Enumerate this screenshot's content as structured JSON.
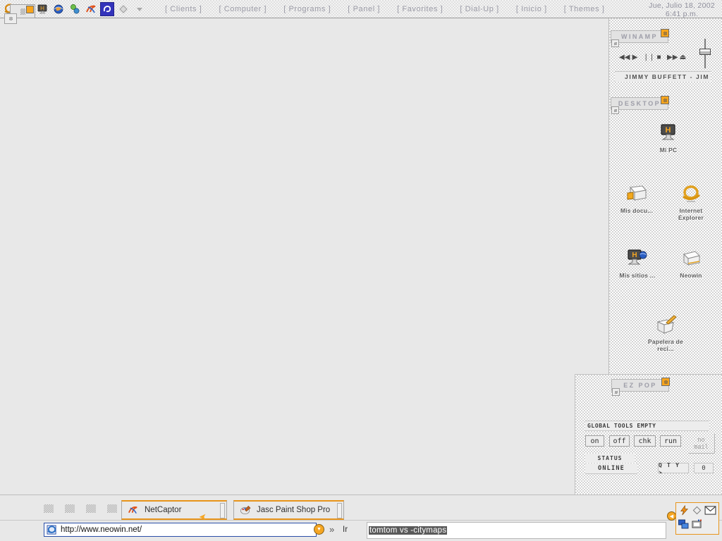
{
  "topbar": {
    "icons": [
      {
        "name": "internet-explorer-icon",
        "glyph": "🌐"
      },
      {
        "name": "white-animal-icon",
        "glyph": "🐕"
      },
      {
        "name": "my-computer-icon",
        "glyph": "🖥"
      },
      {
        "name": "globe-icon",
        "glyph": "🌎"
      },
      {
        "name": "spheres-icon",
        "glyph": "⊙"
      },
      {
        "name": "netcaptor-icon",
        "glyph": "↗"
      },
      {
        "name": "active-app-icon",
        "glyph": "◐"
      },
      {
        "name": "diamond-icon",
        "glyph": "◇"
      },
      {
        "name": "chevron-down-icon",
        "glyph": "▾"
      }
    ],
    "menus": [
      "[ Clients ]",
      "[ Computer ]",
      "[ Programs ]",
      "[ Panel ]",
      "[ Favorites ]",
      "[ Dial-Up ]",
      "[ Inicio ]",
      "[ Themes ]"
    ],
    "clock": {
      "date": "Jue, Julio 18, 2002",
      "time": "6:41 p.m."
    }
  },
  "winamp": {
    "title": "WINAMP",
    "controls": [
      {
        "name": "previous-track-button",
        "glyph": "◀◀"
      },
      {
        "name": "play-button",
        "glyph": "▶"
      },
      {
        "name": "pause-button",
        "glyph": "❘❘"
      },
      {
        "name": "stop-button",
        "glyph": "■"
      },
      {
        "name": "next-track-button",
        "glyph": "▶▶"
      },
      {
        "name": "eject-button",
        "glyph": "⏏"
      }
    ],
    "track": "JIMMY BUFFETT - JIM"
  },
  "desktop": {
    "title": "DESKTOP",
    "icons": [
      {
        "name": "mi-pc",
        "label": "Mi PC",
        "glyph": "🖥"
      },
      {
        "name": "mis-documentos",
        "label": "Mis docu...",
        "glyph": "📁"
      },
      {
        "name": "internet-explorer",
        "label": "Internet Explorer",
        "glyph": "℮"
      },
      {
        "name": "mis-sitios-de-red",
        "label": "Mis sitios ...",
        "glyph": "🖧"
      },
      {
        "name": "neowin",
        "label": "Neowin",
        "glyph": "✉"
      },
      {
        "name": "papelera-de-reciclaje",
        "label": "Papelera de reci...",
        "glyph": "🗑"
      }
    ]
  },
  "ezpop": {
    "title": "EZ POP",
    "global_tools": "GLOBAL TOOLS EMPTY",
    "buttons": [
      "on",
      "off",
      "chk",
      "run"
    ],
    "mail_state": "no\nmail",
    "mail_state_line1": "no",
    "mail_state_line2": "mail",
    "status_label": "STATUS",
    "status_value": "ONLINE",
    "qty_label": "Q T Y ↘",
    "qty_value": "0"
  },
  "taskbar": {
    "tasks": [
      {
        "name": "netcaptor",
        "label": "NetCaptor",
        "icon": "↗"
      },
      {
        "name": "jasc-paint-shop-pro",
        "label": "Jasc Paint Shop Pro",
        "icon": "🎨"
      }
    ],
    "quicklaunch_count": 4
  },
  "browserbar": {
    "address_icon": "℮",
    "address_value": "http://www.neowin.net/",
    "go_label": "Ir",
    "search_value": "tomtom vs -citymaps"
  },
  "tray": {
    "icons": [
      {
        "name": "lightning-icon",
        "glyph": "⚡"
      },
      {
        "name": "diamond-icon",
        "glyph": "◇"
      },
      {
        "name": "mail-icon",
        "glyph": "✉"
      },
      {
        "name": "network-icon",
        "glyph": "🖧"
      },
      {
        "name": "display-properties-icon",
        "glyph": "🖵"
      }
    ]
  },
  "colors": {
    "accent_orange": "#e8941a",
    "desktop_gray": "#e8e8e8",
    "menu_text": "#9b9ba6",
    "selection_dark": "#5a5a5a",
    "addr_border_blue": "#2b4fa8"
  }
}
